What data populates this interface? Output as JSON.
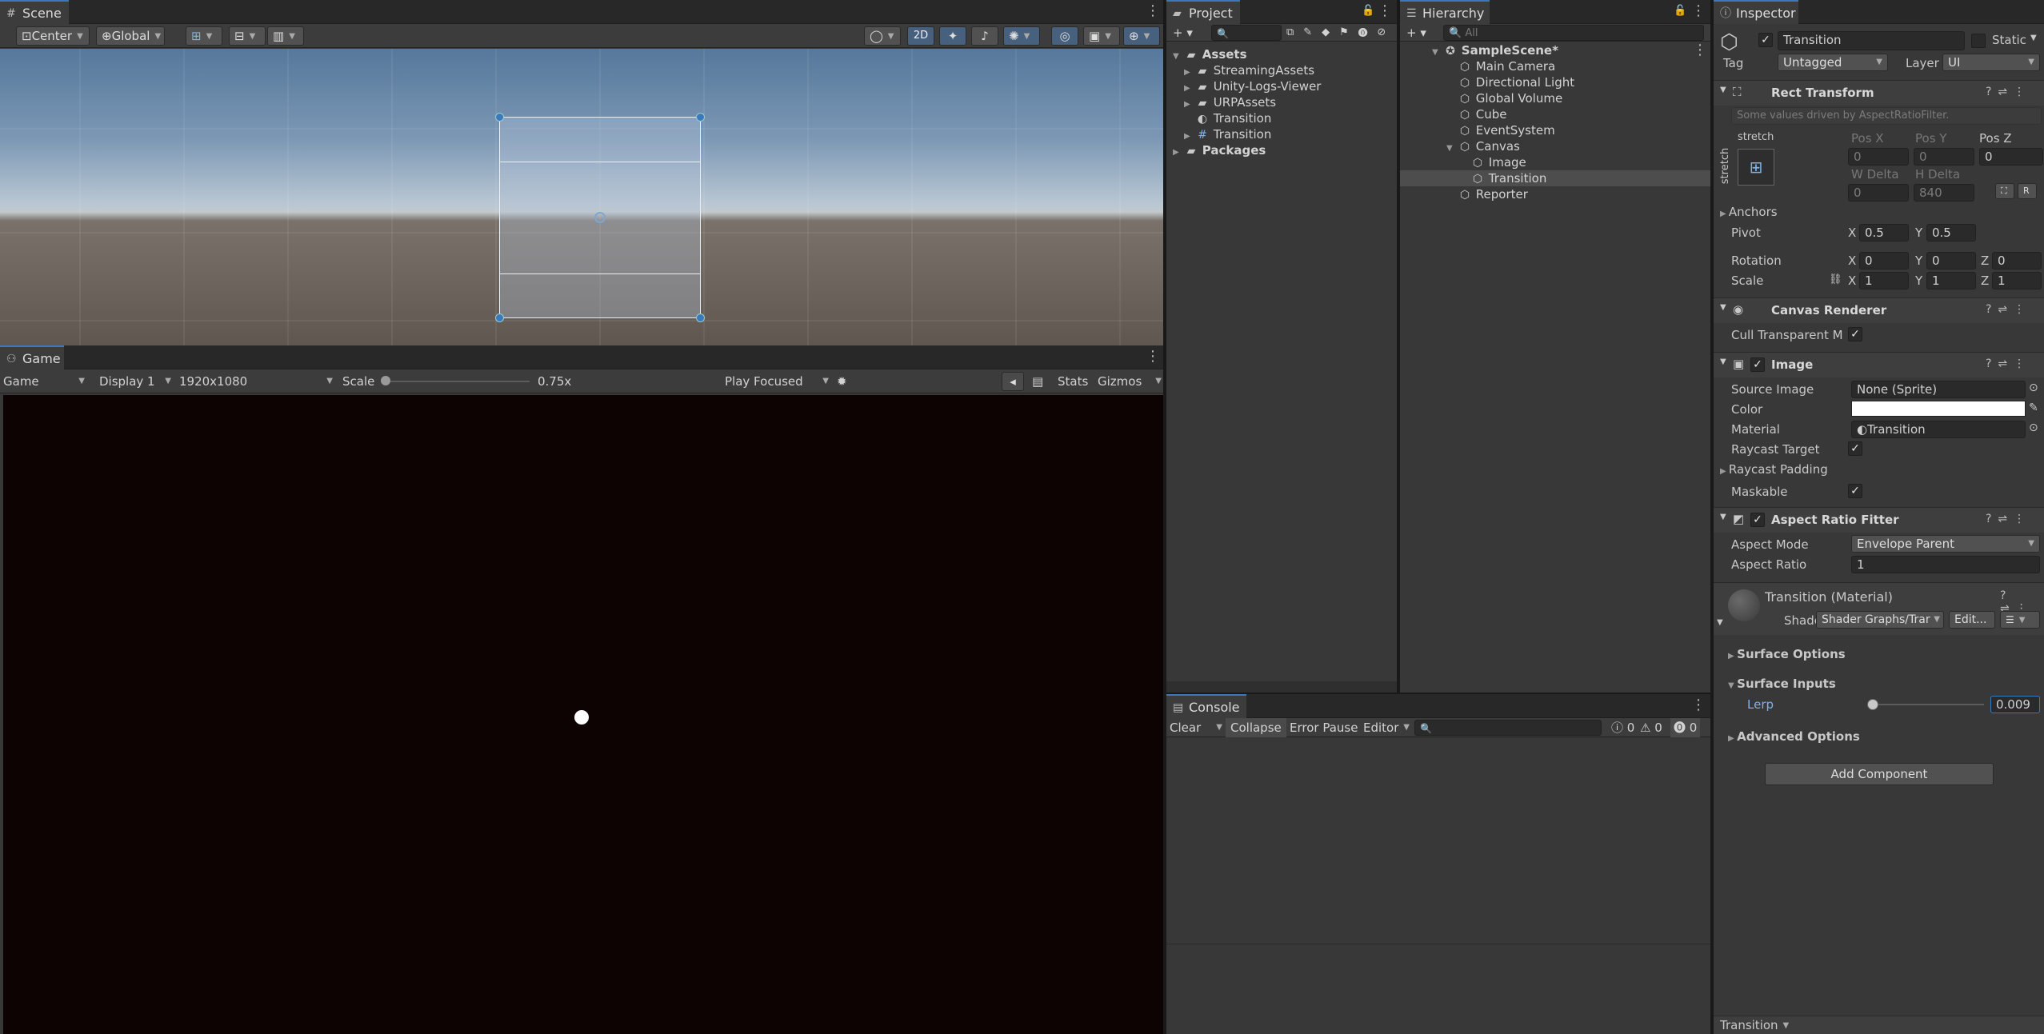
{
  "scene": {
    "tab": "Scene",
    "pivot_mode": "Center",
    "space_mode": "Global",
    "mode_2d": "2D"
  },
  "game": {
    "tab": "Game",
    "view": "Game",
    "display": "Display 1",
    "resolution": "1920x1080",
    "scale_label": "Scale",
    "scale_value": "0.75x",
    "play_mode": "Play Focused",
    "stats": "Stats",
    "gizmos": "Gizmos"
  },
  "project": {
    "tab": "Project",
    "items": [
      "Assets",
      "StreamingAssets",
      "Unity-Logs-Viewer",
      "URPAssets",
      "Transition",
      "Transition",
      "Packages"
    ]
  },
  "hierarchy": {
    "tab": "Hierarchy",
    "search_placeholder": "All",
    "items": [
      "SampleScene*",
      "Main Camera",
      "Directional Light",
      "Global Volume",
      "Cube",
      "EventSystem",
      "Canvas",
      "Image",
      "Transition",
      "Reporter"
    ]
  },
  "console": {
    "tab": "Console",
    "clear": "Clear",
    "collapse": "Collapse",
    "error_pause": "Error Pause",
    "editor": "Editor",
    "log_count": "0",
    "warn_count": "0",
    "error_count": "0"
  },
  "inspector": {
    "tab": "Inspector",
    "object_name": "Transition",
    "static_label": "Static",
    "tag_label": "Tag",
    "tag_value": "Untagged",
    "layer_label": "Layer",
    "layer_value": "UI",
    "rect_transform": {
      "title": "Rect Transform",
      "note": "Some values driven by AspectRatioFilter.",
      "anchor_preset": "stretch",
      "pos_x_label": "Pos X",
      "pos_x": "0",
      "pos_y_label": "Pos Y",
      "pos_y": "0",
      "pos_z_label": "Pos Z",
      "pos_z": "0",
      "w_label": "W Delta",
      "w": "0",
      "h_label": "H Delta",
      "h": "840",
      "r_button": "R",
      "anchors": "Anchors",
      "pivot_label": "Pivot",
      "pivot_x": "0.5",
      "pivot_y": "0.5",
      "rotation_label": "Rotation",
      "rot_x": "0",
      "rot_y": "0",
      "rot_z": "0",
      "scale_label": "Scale",
      "scale_x": "1",
      "scale_y": "1",
      "scale_z": "1",
      "axis_x": "X",
      "axis_y": "Y",
      "axis_z": "Z"
    },
    "canvas_renderer": {
      "title": "Canvas Renderer",
      "cull_label": "Cull Transparent Me"
    },
    "image": {
      "title": "Image",
      "source_label": "Source Image",
      "source_value": "None (Sprite)",
      "color_label": "Color",
      "material_label": "Material",
      "material_value": "Transition",
      "raycast_label": "Raycast Target",
      "raycast_padding": "Raycast Padding",
      "maskable_label": "Maskable"
    },
    "aspect": {
      "title": "Aspect Ratio Fitter",
      "mode_label": "Aspect Mode",
      "mode_value": "Envelope Parent",
      "ratio_label": "Aspect Ratio",
      "ratio_value": "1"
    },
    "material": {
      "title": "Transition (Material)",
      "shader_label": "Shader",
      "shader_value": "Shader Graphs/Trar",
      "edit": "Edit...",
      "surface_options": "Surface Options",
      "surface_inputs": "Surface Inputs",
      "lerp_label": "Lerp",
      "lerp_value": "0.009",
      "lerp_fraction": 0.009,
      "advanced": "Advanced Options"
    },
    "add_component": "Add Component",
    "footer": "Transition"
  },
  "colors": {
    "accent": "#3a79bb",
    "panel": "#383838",
    "game_bg": "#0d0303"
  }
}
